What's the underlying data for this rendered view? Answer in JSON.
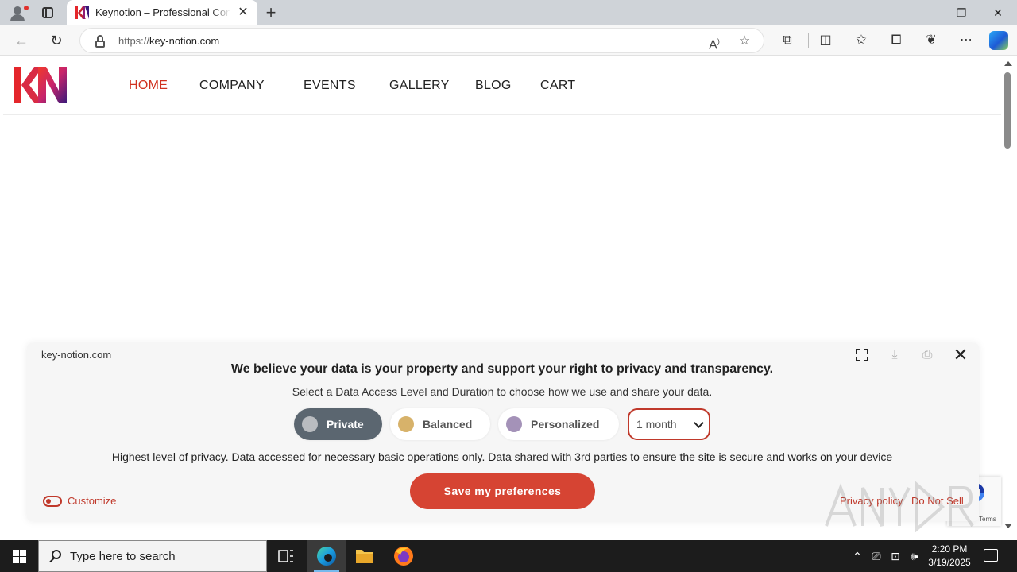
{
  "browser": {
    "tab_title": "Keynotion – Professional Conferences",
    "new_tab_symbol": "+",
    "url_protocol": "https://",
    "url_host": "key-notion.com",
    "window_controls": {
      "minimize": "—",
      "restore": "❐",
      "close": "✕"
    }
  },
  "site": {
    "nav": [
      "HOME",
      "COMPANY",
      "EVENTS",
      "GALLERY",
      "BLOG",
      "CART"
    ],
    "active_nav": "HOME",
    "brand_colors": [
      "#e4262b",
      "#8f1d74",
      "#3a1a7a"
    ]
  },
  "consent": {
    "domain": "key-notion.com",
    "heading": "We believe your data is your property and support your right to privacy and transparency.",
    "subheading": "Select a Data Access Level and Duration to choose how we use and share your data.",
    "levels": [
      {
        "label": "Private",
        "color": "#b9bcc0",
        "selected": true
      },
      {
        "label": "Balanced",
        "color": "#d7b26a",
        "selected": false
      },
      {
        "label": "Personalized",
        "color": "#a492b8",
        "selected": false
      }
    ],
    "duration": "1 month",
    "description": "Highest level of privacy. Data accessed for necessary basic operations only. Data shared with 3rd parties to ensure the site is secure and works on your device",
    "save_label": "Save my preferences",
    "customize_label": "Customize",
    "privacy_label": "Privacy policy",
    "donotsell_label": "Do Not Sell",
    "accent_color": "#d64433"
  },
  "recaptcha": {
    "terms": "Terms"
  },
  "taskbar": {
    "search_placeholder": "Type here to search",
    "time": "2:20 PM",
    "date": "3/19/2025"
  }
}
